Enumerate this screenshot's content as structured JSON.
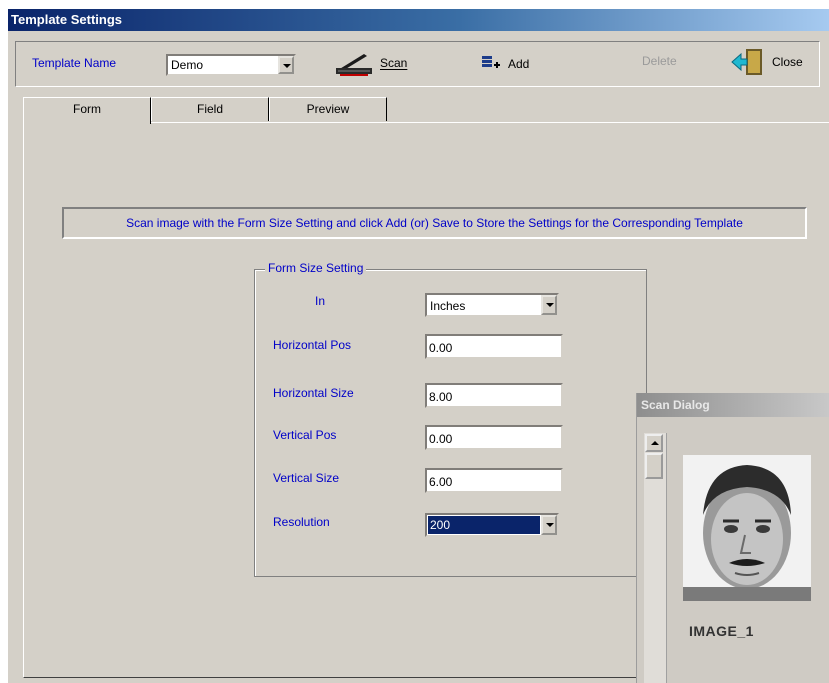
{
  "window": {
    "title": "Template Settings"
  },
  "toolbar": {
    "template_name_label": "Template Name",
    "template_name_value": "Demo",
    "scan_label": "Scan",
    "add_label": "Add",
    "delete_label": "Delete",
    "close_label": "Close"
  },
  "tabs": [
    {
      "label": "Form",
      "active": true
    },
    {
      "label": "Field",
      "active": false
    },
    {
      "label": "Preview",
      "active": false
    }
  ],
  "banner": "Scan image with the Form Size Setting and click Add (or) Save to Store the Settings for the Corresponding Template",
  "form_size": {
    "legend": "Form Size Setting",
    "in_label": "In",
    "in_value": "Inches",
    "hpos_label": "Horizontal Pos",
    "hpos_value": "0.00",
    "hsize_label": "Horizontal Size",
    "hsize_value": "8.00",
    "vpos_label": "Vertical Pos",
    "vpos_value": "0.00",
    "vsize_label": "Vertical Size",
    "vsize_value": "6.00",
    "resolution_label": "Resolution",
    "resolution_value": "200"
  },
  "scan_dialog": {
    "title": "Scan Dialog",
    "image_label": "IMAGE_1"
  },
  "colors": {
    "label_blue": "#0000c8",
    "title_bar": "#0a246a",
    "selection": "#0a246a"
  }
}
